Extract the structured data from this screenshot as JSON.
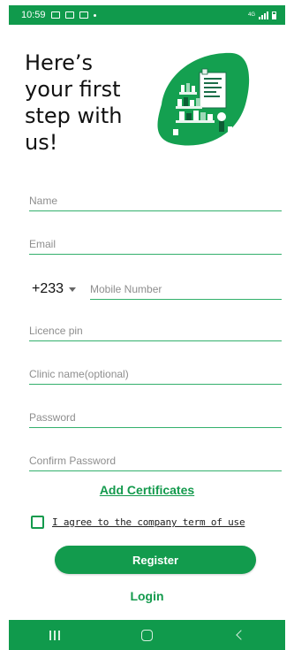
{
  "status_bar": {
    "time": "10:59",
    "network_label": "4G",
    "icons": [
      "gallery-icon",
      "mail-icon",
      "notification-icon",
      "signal-icon",
      "battery-icon"
    ]
  },
  "header": {
    "title": "Here’s your first step with us!"
  },
  "form": {
    "name_placeholder": "Name",
    "email_placeholder": "Email",
    "country_code": "+233",
    "mobile_placeholder": "Mobile Number",
    "licence_placeholder": "Licence pin",
    "clinic_placeholder": "Clinic name(optional)",
    "password_placeholder": "Password",
    "confirm_password_placeholder": "Confirm Password"
  },
  "actions": {
    "add_certificates": "Add Certificates",
    "agree_label": "I agree to the company term of use",
    "register": "Register",
    "login": "Login"
  },
  "colors": {
    "primary": "#149a4d",
    "bar": "#109a4c",
    "underline": "#33b06c"
  }
}
